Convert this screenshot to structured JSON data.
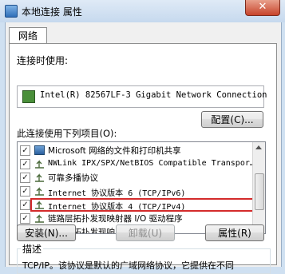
{
  "window": {
    "title": "本地连接 属性",
    "close_label": "✕"
  },
  "tabs": [
    {
      "label": "网络"
    }
  ],
  "connect_using_label": "连接时使用:",
  "adapter_name": "Intel(R) 82567LF-3 Gigabit Network Connection",
  "configure_button": "配置(C)...",
  "items_label": "此连接使用下列项目(O):",
  "items": [
    {
      "label": "Microsoft 网络的文件和打印机共享",
      "checked": true,
      "icon": "network-service-icon"
    },
    {
      "label": "NWLink IPX/SPX/NetBIOS Compatible Transpor…",
      "checked": true,
      "icon": "protocol-icon"
    },
    {
      "label": "可靠多播协议",
      "checked": true,
      "icon": "protocol-icon"
    },
    {
      "label": "Internet 协议版本 6 (TCP/IPv6)",
      "checked": true,
      "icon": "protocol-icon"
    },
    {
      "label": "Internet 协议版本 4 (TCP/IPv4)",
      "checked": true,
      "icon": "protocol-icon",
      "highlighted": true
    },
    {
      "label": "链路层拓扑发现映射器 I/O 驱动程序",
      "checked": true,
      "icon": "protocol-icon"
    },
    {
      "label": "链路层拓扑发现响应程序",
      "checked": true,
      "icon": "protocol-icon"
    }
  ],
  "buttons": {
    "install": "安装(N)...",
    "uninstall": "卸载(U)",
    "properties": "属性(R)"
  },
  "description": {
    "title": "描述",
    "text": "TCP/IP。该协议是默认的广域网络协议，它提供在不同"
  },
  "colors": {
    "highlight_border": "#d42b2b",
    "titlebar": "#c6d9ee"
  }
}
